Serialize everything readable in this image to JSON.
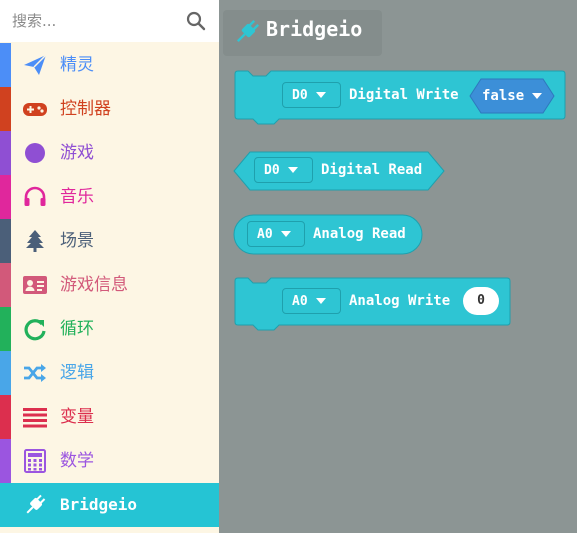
{
  "search": {
    "placeholder": "搜索..."
  },
  "categories": [
    {
      "label": "精灵",
      "color": "#4c8ef7",
      "bar": "#4c8ef7"
    },
    {
      "label": "控制器",
      "color": "#d0411f",
      "bar": "#d0411f"
    },
    {
      "label": "游戏",
      "color": "#8f4fd3",
      "bar": "#8f4fd3"
    },
    {
      "label": "音乐",
      "color": "#e0279c",
      "bar": "#e0279c"
    },
    {
      "label": "场景",
      "color": "#4b5f79",
      "bar": "#4b5f79"
    },
    {
      "label": "游戏信息",
      "color": "#d2597a",
      "bar": "#d2597a"
    },
    {
      "label": "循环",
      "color": "#22b15b",
      "bar": "#22b15b"
    },
    {
      "label": "逻辑",
      "color": "#49a6e8",
      "bar": "#49a6e8"
    },
    {
      "label": "变量",
      "color": "#dc2f4e",
      "bar": "#dc2f4e"
    },
    {
      "label": "数学",
      "color": "#9b55e0",
      "bar": "#9b55e0"
    },
    {
      "label": "Bridgeio",
      "color": "#ffffff",
      "bar": "#25c4d4",
      "selected": true
    }
  ],
  "flyout": {
    "title": "Bridgeio",
    "blocks": {
      "digital_write": {
        "pin": "D0",
        "label": "Digital Write",
        "value": "false"
      },
      "digital_read": {
        "pin": "D0",
        "label": "Digital Read"
      },
      "analog_read": {
        "pin": "A0",
        "label": "Analog Read"
      },
      "analog_write": {
        "pin": "A0",
        "label": "Analog Write",
        "value": "0"
      }
    }
  },
  "colors": {
    "block": "#2ec5d3",
    "block_border": "#1fa0ad",
    "bool_input": "#3c8fd8",
    "workspace": "#8c9594"
  }
}
